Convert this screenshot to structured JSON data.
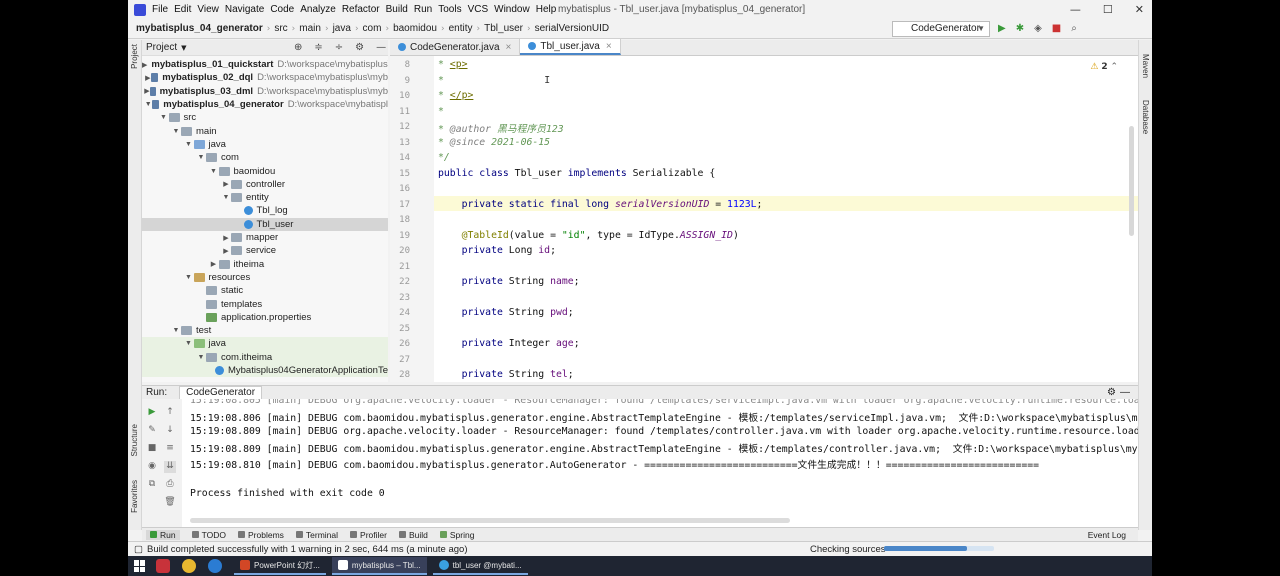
{
  "menubar": {
    "items": [
      "File",
      "Edit",
      "View",
      "Navigate",
      "Code",
      "Analyze",
      "Refactor",
      "Build",
      "Run",
      "Tools",
      "VCS",
      "Window",
      "Help"
    ],
    "window_title": "mybatisplus - Tbl_user.java [mybatisplus_04_generator]"
  },
  "navbar": {
    "crumbs": [
      "mybatisplus_04_generator",
      "src",
      "main",
      "java",
      "com",
      "baomidou",
      "entity",
      "Tbl_user",
      "serialVersionUID"
    ],
    "run_config": "CodeGenerator"
  },
  "project": {
    "title": "Project",
    "tree": [
      {
        "label": "mybatisplus_01_quickstart",
        "path": "D:\\workspace\\mybatisplus\\myb",
        "bold": true,
        "indent": 0,
        "arrow": "right",
        "icon": "mod"
      },
      {
        "label": "mybatisplus_02_dql",
        "path": "D:\\workspace\\mybatisplus\\myb",
        "bold": true,
        "indent": 0,
        "arrow": "right",
        "icon": "mod"
      },
      {
        "label": "mybatisplus_03_dml",
        "path": "D:\\workspace\\mybatisplus\\myb",
        "bold": true,
        "indent": 0,
        "arrow": "right",
        "icon": "mod"
      },
      {
        "label": "mybatisplus_04_generator",
        "path": "D:\\workspace\\mybatispl",
        "bold": true,
        "indent": 0,
        "arrow": "down",
        "icon": "mod"
      },
      {
        "label": "src",
        "indent": 1,
        "arrow": "down",
        "icon": "folder"
      },
      {
        "label": "main",
        "indent": 2,
        "arrow": "down",
        "icon": "folder"
      },
      {
        "label": "java",
        "indent": 3,
        "arrow": "down",
        "icon": "src"
      },
      {
        "label": "com",
        "indent": 4,
        "arrow": "down",
        "icon": "folder"
      },
      {
        "label": "baomidou",
        "indent": 5,
        "arrow": "down",
        "icon": "folder"
      },
      {
        "label": "controller",
        "indent": 6,
        "arrow": "right",
        "icon": "folder"
      },
      {
        "label": "entity",
        "indent": 6,
        "arrow": "down",
        "icon": "folder"
      },
      {
        "label": "Tbl_log",
        "indent": 7,
        "arrow": "",
        "icon": "cls"
      },
      {
        "label": "Tbl_user",
        "indent": 7,
        "arrow": "",
        "icon": "cls",
        "selected": true
      },
      {
        "label": "mapper",
        "indent": 6,
        "arrow": "right",
        "icon": "folder"
      },
      {
        "label": "service",
        "indent": 6,
        "arrow": "right",
        "icon": "folder"
      },
      {
        "label": "itheima",
        "indent": 5,
        "arrow": "right",
        "icon": "folder"
      },
      {
        "label": "resources",
        "indent": 3,
        "arrow": "down",
        "icon": "res"
      },
      {
        "label": "static",
        "indent": 4,
        "arrow": "",
        "icon": "folder"
      },
      {
        "label": "templates",
        "indent": 4,
        "arrow": "",
        "icon": "folder"
      },
      {
        "label": "application.properties",
        "indent": 4,
        "arrow": "",
        "icon": "props"
      },
      {
        "label": "test",
        "indent": 2,
        "arrow": "down",
        "icon": "folder"
      },
      {
        "label": "java",
        "indent": 3,
        "arrow": "down",
        "icon": "test",
        "green": true
      },
      {
        "label": "com.itheima",
        "indent": 4,
        "arrow": "down",
        "icon": "folder",
        "green": true
      },
      {
        "label": "Mybatisplus04GeneratorApplicationTe",
        "indent": 5,
        "arrow": "",
        "icon": "cls",
        "green": true
      }
    ]
  },
  "editor": {
    "tabs": [
      {
        "label": "CodeGenerator.java",
        "active": false
      },
      {
        "label": "Tbl_user.java",
        "active": true
      }
    ],
    "warning_count": "2",
    "line_numbers": [
      "8",
      "9",
      "10",
      "11",
      "12",
      "13",
      "14",
      "15",
      "16",
      "17",
      "18",
      "19",
      "20",
      "21",
      "22",
      "23",
      "24",
      "25",
      "26",
      "27",
      "28"
    ]
  },
  "run": {
    "label": "Run:",
    "tab": "CodeGenerator",
    "lines": [
      "15:19:08.806 [main] DEBUG com.baomidou.mybatisplus.generator.engine.AbstractTemplateEngine - 模板:/templates/serviceImpl.java.vm;  文件:D:\\workspace\\mybatisplus\\my",
      "15:19:08.809 [main] DEBUG org.apache.velocity.loader - ResourceManager: found /templates/controller.java.vm with loader org.apache.velocity.runtime.resource.loade",
      "15:19:08.809 [main] DEBUG com.baomidou.mybatisplus.generator.engine.AbstractTemplateEngine - 模板:/templates/controller.java.vm;  文件:D:\\workspace\\mybatisplus\\myb",
      "15:19:08.810 [main] DEBUG com.baomidou.mybatisplus.generator.AutoGenerator - ==========================文件生成完成！！！==========================",
      "",
      "Process finished with exit code 0"
    ]
  },
  "bottom_tabs": [
    "Run",
    "TODO",
    "Problems",
    "Terminal",
    "Profiler",
    "Build",
    "Spring"
  ],
  "event_log": "Event Log",
  "status": {
    "message": "Build completed successfully with 1 warning in 2 sec, 644 ms (a minute ago)",
    "checking": "Checking sources",
    "progress": 0.75
  },
  "taskbar": {
    "windows": [
      "PowerPoint 幻灯...",
      "mybatisplus – Tbl...",
      "tbl_user @mybati..."
    ]
  },
  "colors": {
    "accent": "#4a86c8",
    "selection": "#d5d5d5",
    "current_line": "#fcfad6"
  }
}
